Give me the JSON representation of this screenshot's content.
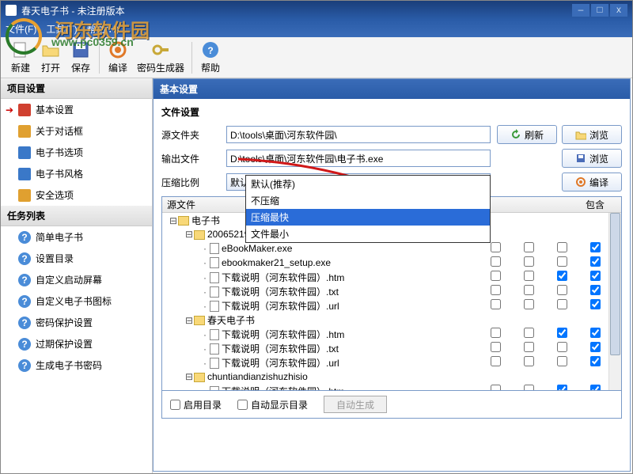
{
  "window": {
    "title": "春天电子书 - 未注册版本"
  },
  "menu": {
    "file": "文件(F)",
    "tools": "工具(T)",
    "help": "帮助(H)"
  },
  "watermark": {
    "text1": "河东软件园",
    "text2": "www.pc0359.cn"
  },
  "toolbar": {
    "new": "新建",
    "open": "打开",
    "save": "保存",
    "compile": "编译",
    "pwdgen": "密码生成器",
    "help": "帮助"
  },
  "sidebar": {
    "proj_header": "项目设置",
    "proj": [
      {
        "label": "基本设置",
        "ic": "#d04030",
        "sel": true
      },
      {
        "label": "关于对话框",
        "ic": "#e0a030"
      },
      {
        "label": "电子书选项",
        "ic": "#3a78c8"
      },
      {
        "label": "电子书风格",
        "ic": "#3a78c8"
      },
      {
        "label": "安全选项",
        "ic": "#e0a030"
      }
    ],
    "task_header": "任务列表",
    "task": [
      {
        "label": "简单电子书"
      },
      {
        "label": "设置目录"
      },
      {
        "label": "自定义启动屏幕"
      },
      {
        "label": "自定义电子书图标"
      },
      {
        "label": "密码保护设置"
      },
      {
        "label": "过期保护设置"
      },
      {
        "label": "生成电子书密码"
      }
    ]
  },
  "main": {
    "header": "基本设置",
    "file_section": "文件设置",
    "src_label": "源文件夹",
    "src_value": "D:\\tools\\桌面\\河东软件园\\",
    "out_label": "输出文件",
    "out_value": "D:\\tools\\桌面\\河东软件园\\电子书.exe",
    "comp_label": "压缩比例",
    "comp_value": "默认(推荐)",
    "btn_refresh": "刷新",
    "btn_browse": "浏览",
    "btn_compile": "编译",
    "comp_opts": [
      "默认(推荐)",
      "不压缩",
      "压缩最快",
      "文件最小"
    ],
    "grid": {
      "h_src": "源文件",
      "h_inc": "包含",
      "rows": [
        {
          "d": 0,
          "t": "f",
          "n": "电子书",
          "exp": "-"
        },
        {
          "d": 1,
          "t": "f",
          "n": "2006521953050",
          "exp": "-"
        },
        {
          "d": 2,
          "t": "x",
          "n": "eBookMaker.exe",
          "c": [
            0,
            0,
            0,
            1
          ]
        },
        {
          "d": 2,
          "t": "x",
          "n": "ebookmaker21_setup.exe",
          "c": [
            0,
            0,
            0,
            1
          ]
        },
        {
          "d": 2,
          "t": "x",
          "n": "下载说明（河东软件园）.htm",
          "c": [
            0,
            0,
            1,
            1
          ]
        },
        {
          "d": 2,
          "t": "x",
          "n": "下载说明（河东软件园）.txt",
          "c": [
            0,
            0,
            0,
            1
          ]
        },
        {
          "d": 2,
          "t": "x",
          "n": "下载说明（河东软件园）.url",
          "c": [
            0,
            0,
            0,
            1
          ]
        },
        {
          "d": 1,
          "t": "f",
          "n": "春天电子书",
          "exp": "-"
        },
        {
          "d": 2,
          "t": "x",
          "n": "下载说明（河东软件园）.htm",
          "c": [
            0,
            0,
            1,
            1
          ]
        },
        {
          "d": 2,
          "t": "x",
          "n": "下载说明（河东软件园）.txt",
          "c": [
            0,
            0,
            0,
            1
          ]
        },
        {
          "d": 2,
          "t": "x",
          "n": "下载说明（河东软件园）.url",
          "c": [
            0,
            0,
            0,
            1
          ]
        },
        {
          "d": 1,
          "t": "f",
          "n": "chuntiandianzishuzhisio",
          "exp": "-"
        },
        {
          "d": 2,
          "t": "x",
          "n": "下载说明（河东软件园）.htm",
          "c": [
            0,
            0,
            1,
            1
          ]
        }
      ]
    },
    "enable_dir": "启用目录",
    "auto_show": "自动显示目录",
    "auto_gen": "自动生成"
  }
}
